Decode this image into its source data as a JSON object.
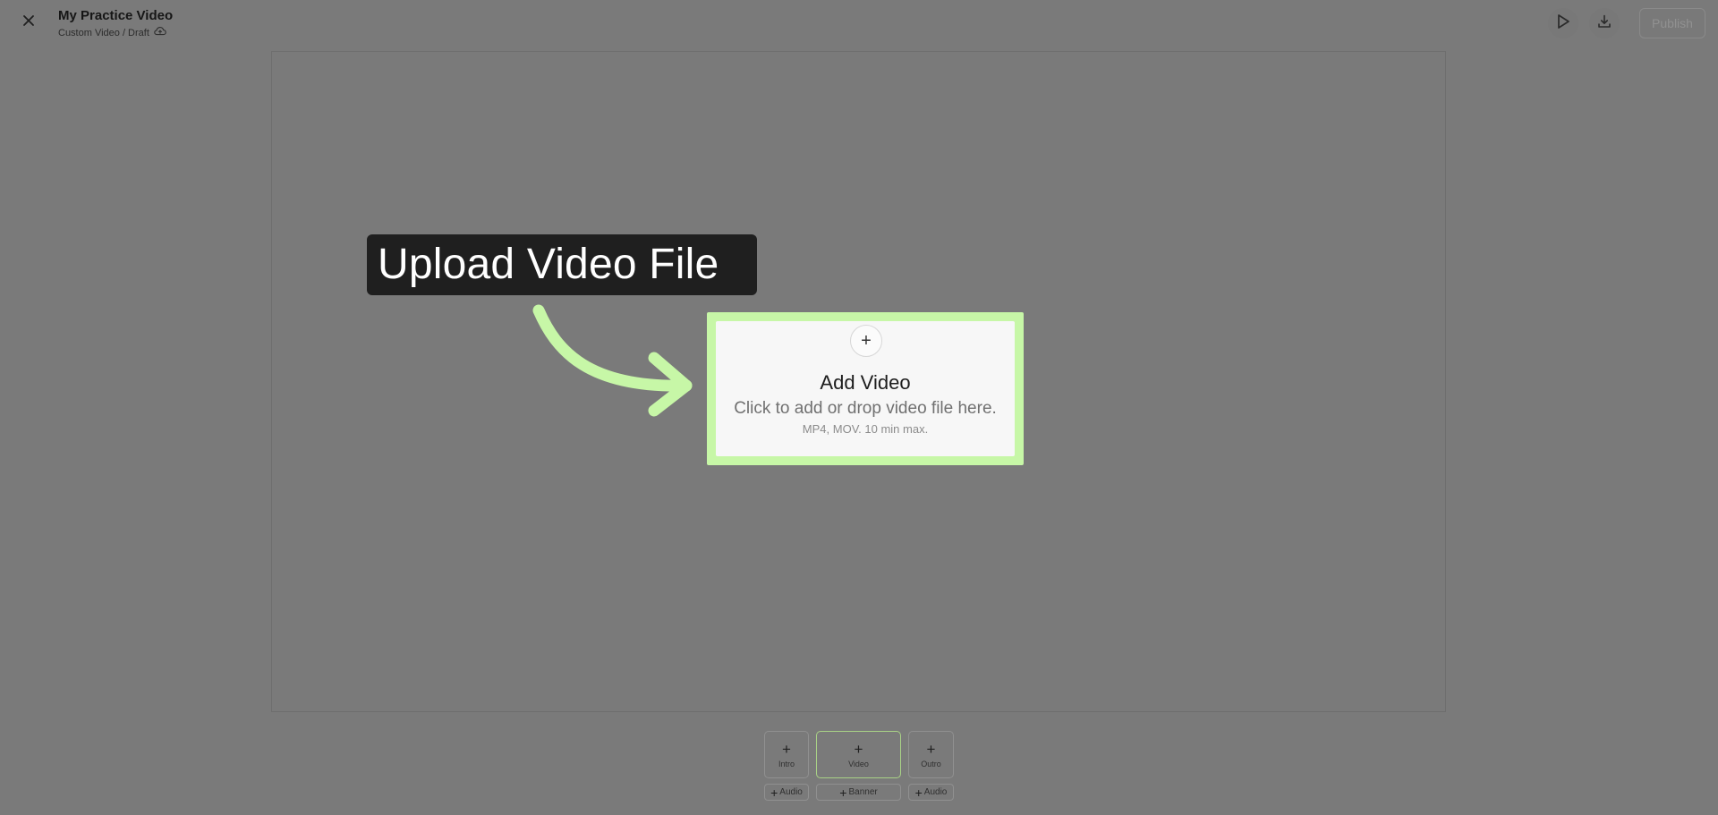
{
  "header": {
    "title": "My Practice Video",
    "subtitle": "Custom Video / Draft",
    "publish_label": "Publish",
    "icons": [
      "close-icon",
      "cloud-sync-icon",
      "play-icon",
      "download-icon"
    ]
  },
  "callout": {
    "text": "Upload Video File"
  },
  "upload": {
    "plus_symbol": "+",
    "title": "Add Video",
    "description": "Click to add or drop video file here.",
    "note": "MP4, MOV. 10 min max."
  },
  "timeline": {
    "segments": [
      {
        "plus": "+",
        "label": "Intro"
      },
      {
        "plus": "+",
        "label": "Video"
      },
      {
        "plus": "+",
        "label": "Outro"
      }
    ],
    "tracks": [
      {
        "plus": "+",
        "label": "Audio"
      },
      {
        "plus": "+",
        "label": "Banner"
      },
      {
        "plus": "+",
        "label": "Audio"
      }
    ]
  },
  "colors": {
    "overlay": "#7a7a7a",
    "accent_green": "#c7f7a7",
    "callout_bg": "#1f1f1f"
  }
}
